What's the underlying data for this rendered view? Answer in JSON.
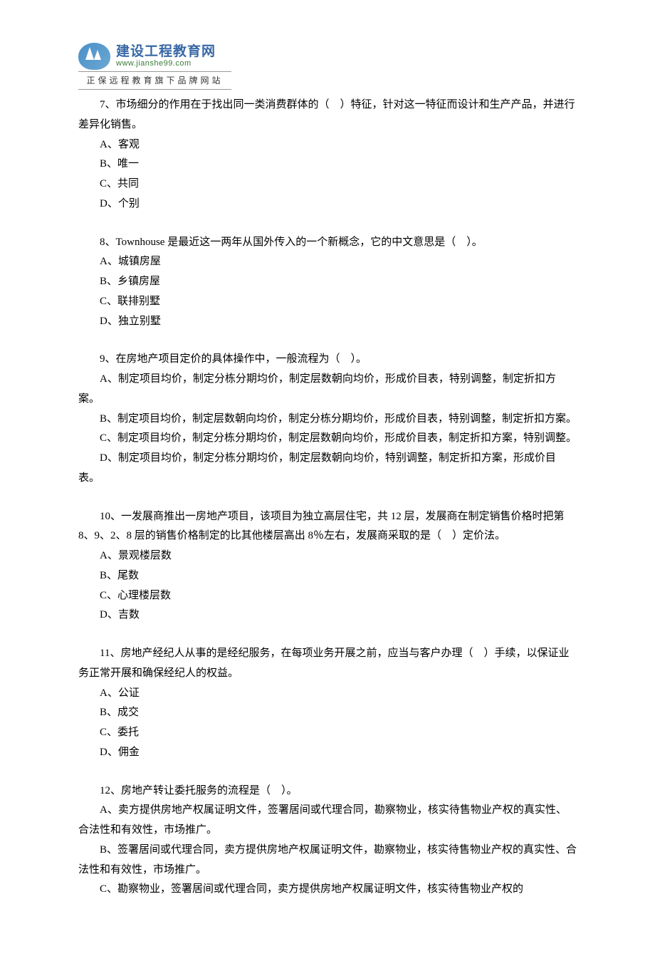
{
  "logo": {
    "title": "建设工程教育网",
    "url": "www.jianshe99.com",
    "subtitle": "正保远程教育旗下品牌网站"
  },
  "questions": [
    {
      "num": "7",
      "text": "7、市场细分的作用在于找出同一类消费群体的（　）特征，针对这一特征而设计和生产产品，并进行差异化销售。",
      "options": {
        "a": "A、客观",
        "b": "B、唯一",
        "c": "C、共同",
        "d": "D、个别"
      }
    },
    {
      "num": "8",
      "text": "8、Townhouse 是最近这一两年从国外传入的一个新概念，它的中文意思是（　）。",
      "options": {
        "a": "A、城镇房屋",
        "b": "B、乡镇房屋",
        "c": "C、联排别墅",
        "d": "D、独立别墅"
      }
    },
    {
      "num": "9",
      "text": "9、在房地产项目定价的具体操作中，一般流程为（　）。",
      "options": {
        "a": "A、制定项目均价，制定分栋分期均价，制定层数朝向均价，形成价目表，特别调整，制定折扣方案。",
        "b": "B、制定项目均价，制定层数朝向均价，制定分栋分期均价，形成价目表，特别调整，制定折扣方案。",
        "c": "C、制定项目均价，制定分栋分期均价，制定层数朝向均价，形成价目表，制定折扣方案，特别调整。",
        "d": "D、制定项目均价，制定分栋分期均价，制定层数朝向均价，特别调整，制定折扣方案，形成价目表。"
      }
    },
    {
      "num": "10",
      "text": "10、一发展商推出一房地产项目，该项目为独立高层住宅，共 12 层，发展商在制定销售价格时把第 8、9、2、8 层的销售价格制定的比其他楼层高出 8％左右，发展商采取的是（　）定价法。",
      "options": {
        "a": "A、景观楼层数",
        "b": "B、尾数",
        "c": "C、心理楼层数",
        "d": "D、吉数"
      }
    },
    {
      "num": "11",
      "text": "11、房地产经纪人从事的是经纪服务，在每项业务开展之前，应当与客户办理（　）手续，以保证业务正常开展和确保经纪人的权益。",
      "options": {
        "a": "A、公证",
        "b": "B、成交",
        "c": "C、委托",
        "d": "D、佣金"
      }
    },
    {
      "num": "12",
      "text": "12、房地产转让委托服务的流程是（　）。",
      "options": {
        "a": "A、卖方提供房地产权属证明文件，签署居间或代理合同，勘察物业，核实待售物业产权的真实性、合法性和有效性，市场推广。",
        "b": "B、签署居间或代理合同，卖方提供房地产权属证明文件，勘察物业，核实待售物业产权的真实性、合法性和有效性，市场推广。",
        "c": "C、勘察物业，签署居间或代理合同，卖方提供房地产权属证明文件，核实待售物业产权的"
      }
    }
  ]
}
